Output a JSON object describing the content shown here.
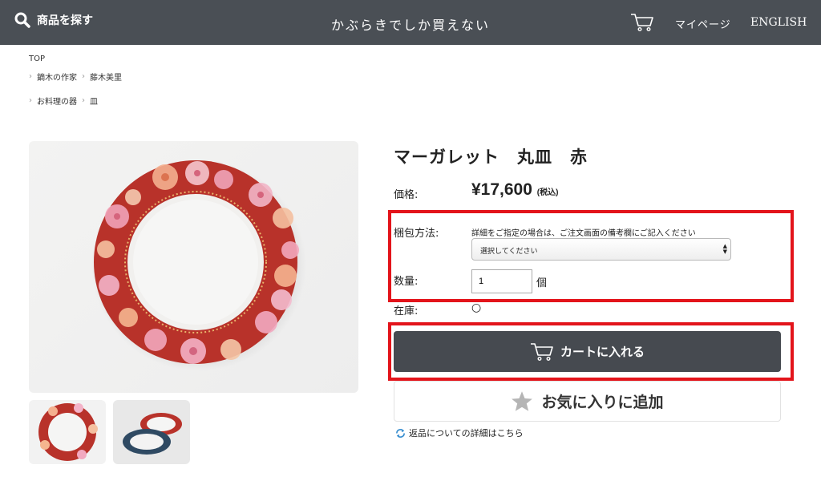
{
  "header": {
    "search_label": "商品を探す",
    "brand": "かぶらきでしか買えない",
    "mypage": "マイページ",
    "english": "ENGLISH"
  },
  "breadcrumb": {
    "top": "TOP",
    "line1": [
      "鏑木の作家",
      "藤木美里"
    ],
    "line2": [
      "お料理の器",
      "皿"
    ]
  },
  "product": {
    "title": "マーガレット　丸皿　赤",
    "price_label": "価格:",
    "price": "¥17,600",
    "price_tax": "(税込)",
    "packing_label": "梱包方法:",
    "packing_note": "詳細をご指定の場合は、ご注文画面の備考欄にご記入ください",
    "packing_select": "選択してください",
    "quantity_label": "数量:",
    "quantity_value": "1",
    "quantity_unit": "個",
    "stock_label": "在庫:",
    "stock_value": "○"
  },
  "actions": {
    "cart_button": "カートに入れる",
    "favorite_button": "お気に入りに追加",
    "return_link": "返品についての詳細はこちら"
  },
  "colors": {
    "header_bg": "#4a4f55",
    "cart_button_bg": "#464a50",
    "highlight": "#e3141b",
    "plate_rim": "#b8322a"
  }
}
